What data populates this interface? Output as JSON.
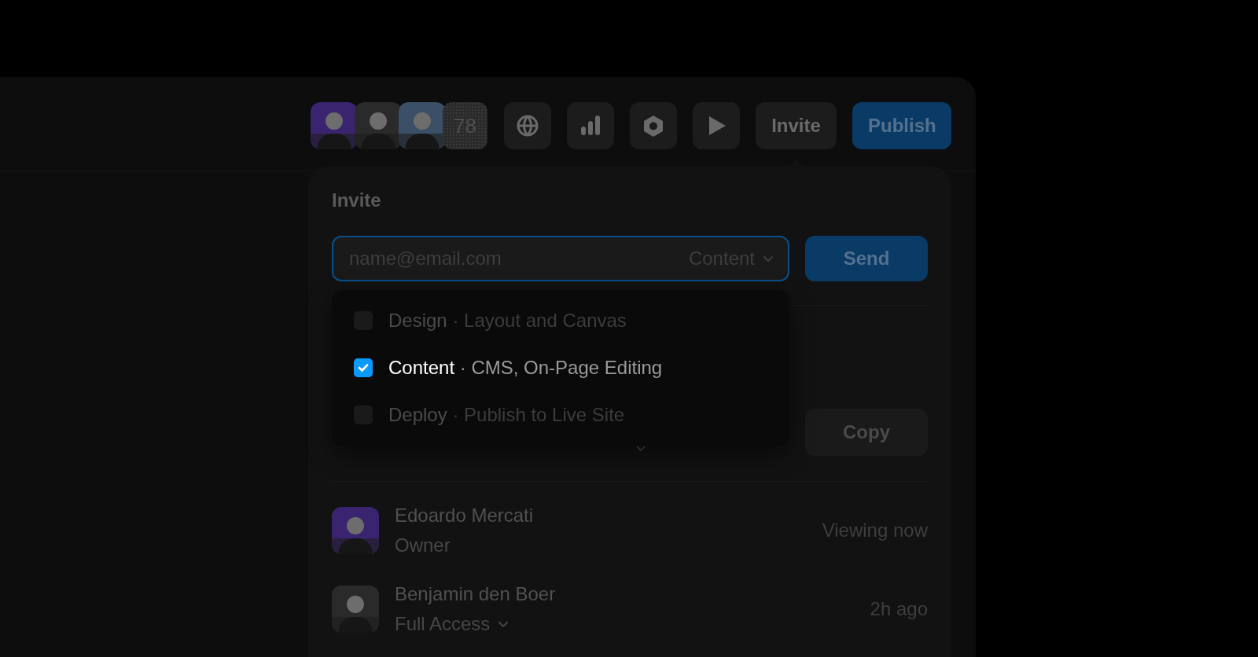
{
  "toolbar": {
    "more_count": "78",
    "invite_button": "Invite",
    "publish_button": "Publish"
  },
  "invite": {
    "title": "Invite",
    "email_field": {
      "placeholder": "name@email.com"
    },
    "role_select": "Content",
    "send_button": "Send",
    "role_menu": [
      {
        "label": "Design",
        "description": "· Layout and Canvas",
        "checked": false
      },
      {
        "label": "Content",
        "description": "· CMS, On-Page Editing",
        "checked": true
      },
      {
        "label": "Deploy",
        "description": "· Publish to Live Site",
        "checked": false
      }
    ],
    "copy_button": "Copy",
    "members": [
      {
        "name": "Edoardo Mercati",
        "role": "Owner",
        "has_menu": false,
        "status": "Viewing now"
      },
      {
        "name": "Benjamin den Boer",
        "role": "Full Access",
        "has_menu": true,
        "status": "2h ago"
      }
    ]
  }
}
